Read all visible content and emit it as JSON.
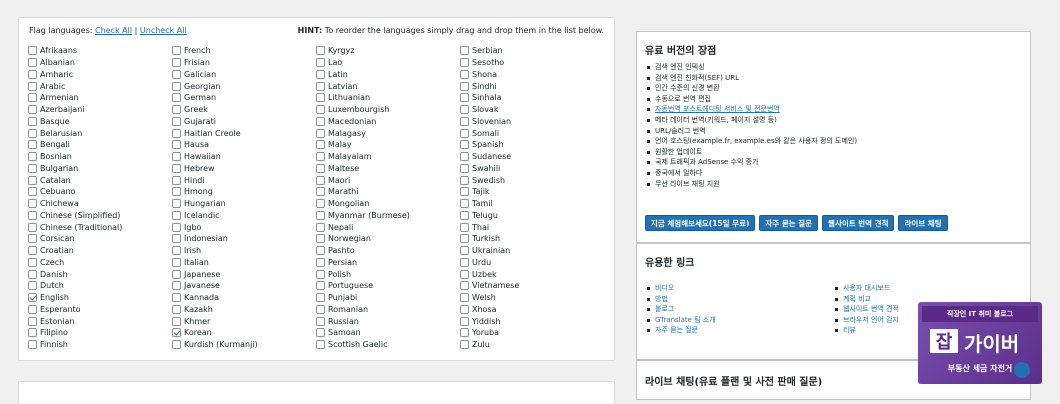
{
  "flag_languages": {
    "label": "Flag languages:",
    "check_all": "Check All",
    "separator": "|",
    "uncheck_all": "Uncheck All",
    "hint_bold": "HINT:",
    "hint_text": "To reorder the languages simply drag and drop them in the list below.",
    "columns": [
      [
        "Afrikaans",
        "Albanian",
        "Amharic",
        "Arabic",
        "Armenian",
        "Azerbaijani",
        "Basque",
        "Belarusian",
        "Bengali",
        "Bosnian",
        "Bulgarian",
        "Catalan",
        "Cebuano",
        "Chichewa",
        "Chinese (Simplified)",
        "Chinese (Traditional)",
        "Corsican",
        "Croatian",
        "Czech",
        "Danish",
        "Dutch",
        "English",
        "Esperanto",
        "Estonian",
        "Filipino",
        "Finnish"
      ],
      [
        "French",
        "Frisian",
        "Galician",
        "Georgian",
        "German",
        "Greek",
        "Gujarati",
        "Haitian Creole",
        "Hausa",
        "Hawaiian",
        "Hebrew",
        "Hindi",
        "Hmong",
        "Hungarian",
        "Icelandic",
        "Igbo",
        "Indonesian",
        "Irish",
        "Italian",
        "Japanese",
        "Javanese",
        "Kannada",
        "Kazakh",
        "Khmer",
        "Korean",
        "Kurdish (Kurmanji)"
      ],
      [
        "Kyrgyz",
        "Lao",
        "Latin",
        "Latvian",
        "Lithuanian",
        "Luxembourgish",
        "Macedonian",
        "Malagasy",
        "Malay",
        "Malayalam",
        "Maltese",
        "Maori",
        "Marathi",
        "Mongolian",
        "Myanmar (Burmese)",
        "Nepali",
        "Norwegian",
        "Pashto",
        "Persian",
        "Polish",
        "Portuguese",
        "Punjabi",
        "Romanian",
        "Russian",
        "Samoan",
        "Scottish Gaelic"
      ],
      [
        "Serbian",
        "Sesotho",
        "Shona",
        "Sindhi",
        "Sinhala",
        "Slovak",
        "Slovenian",
        "Somali",
        "Spanish",
        "Sudanese",
        "Swahili",
        "Swedish",
        "Tajik",
        "Tamil",
        "Telugu",
        "Thai",
        "Turkish",
        "Ukrainian",
        "Urdu",
        "Uzbek",
        "Vietnamese",
        "Welsh",
        "Xhosa",
        "Yiddish",
        "Yoruba",
        "Zulu"
      ]
    ],
    "checked": [
      "English",
      "Korean"
    ]
  },
  "paid_box": {
    "title": "유료 버전의 장점",
    "items": [
      {
        "text": "검색 엔진 인덱싱",
        "link": false
      },
      {
        "text": "검색 엔진 친화적(SEF) URL",
        "link": false
      },
      {
        "text": "인간 수준의 신경 변환",
        "link": false
      },
      {
        "text": "수동으로 번역 편집",
        "link": false
      },
      {
        "text": "자동번역 포스트에디팅 서비스 및 전문번역",
        "link": true
      },
      {
        "text": "메타 데이터 번역(키워드, 페이지 설명 등)",
        "link": false
      },
      {
        "text": "URL/슬러그 번역",
        "link": false
      },
      {
        "text": "언어 호스팅(example.fr, example.es와 같은 사용자 정의 도메인)",
        "link": false
      },
      {
        "text": "원활한 업데이트",
        "link": false
      },
      {
        "text": "국제 트래픽과 AdSense 수익 증가",
        "link": false
      },
      {
        "text": "중국에서 일하다",
        "link": false
      },
      {
        "text": "무선 라이브 채팅 지원",
        "link": false
      }
    ],
    "buttons": [
      "지금 체험해보세요(15일 무료)",
      "자주 묻는 질문",
      "웹사이트 번역 견적",
      "라이브 채팅"
    ]
  },
  "links_box": {
    "title": "유용한 링크",
    "left": [
      "비디오",
      "방법",
      "블로그",
      "GTranslate 팀 소개",
      "자주 묻는 질문"
    ],
    "right": [
      "사용자 대시보드",
      "계획 비교",
      "웹사이트 번역 견적",
      "브라우저 언어 감지",
      "리뷰"
    ]
  },
  "chat_box": {
    "title": "라이브 채팅(유료 플랜 및 사전 판매 질문)"
  },
  "watermark": {
    "top_text": "직장인 IT 취미 블로그",
    "logo_char": "잡",
    "name": "가이버",
    "bottom_text": "부동산 세금 자전거"
  }
}
